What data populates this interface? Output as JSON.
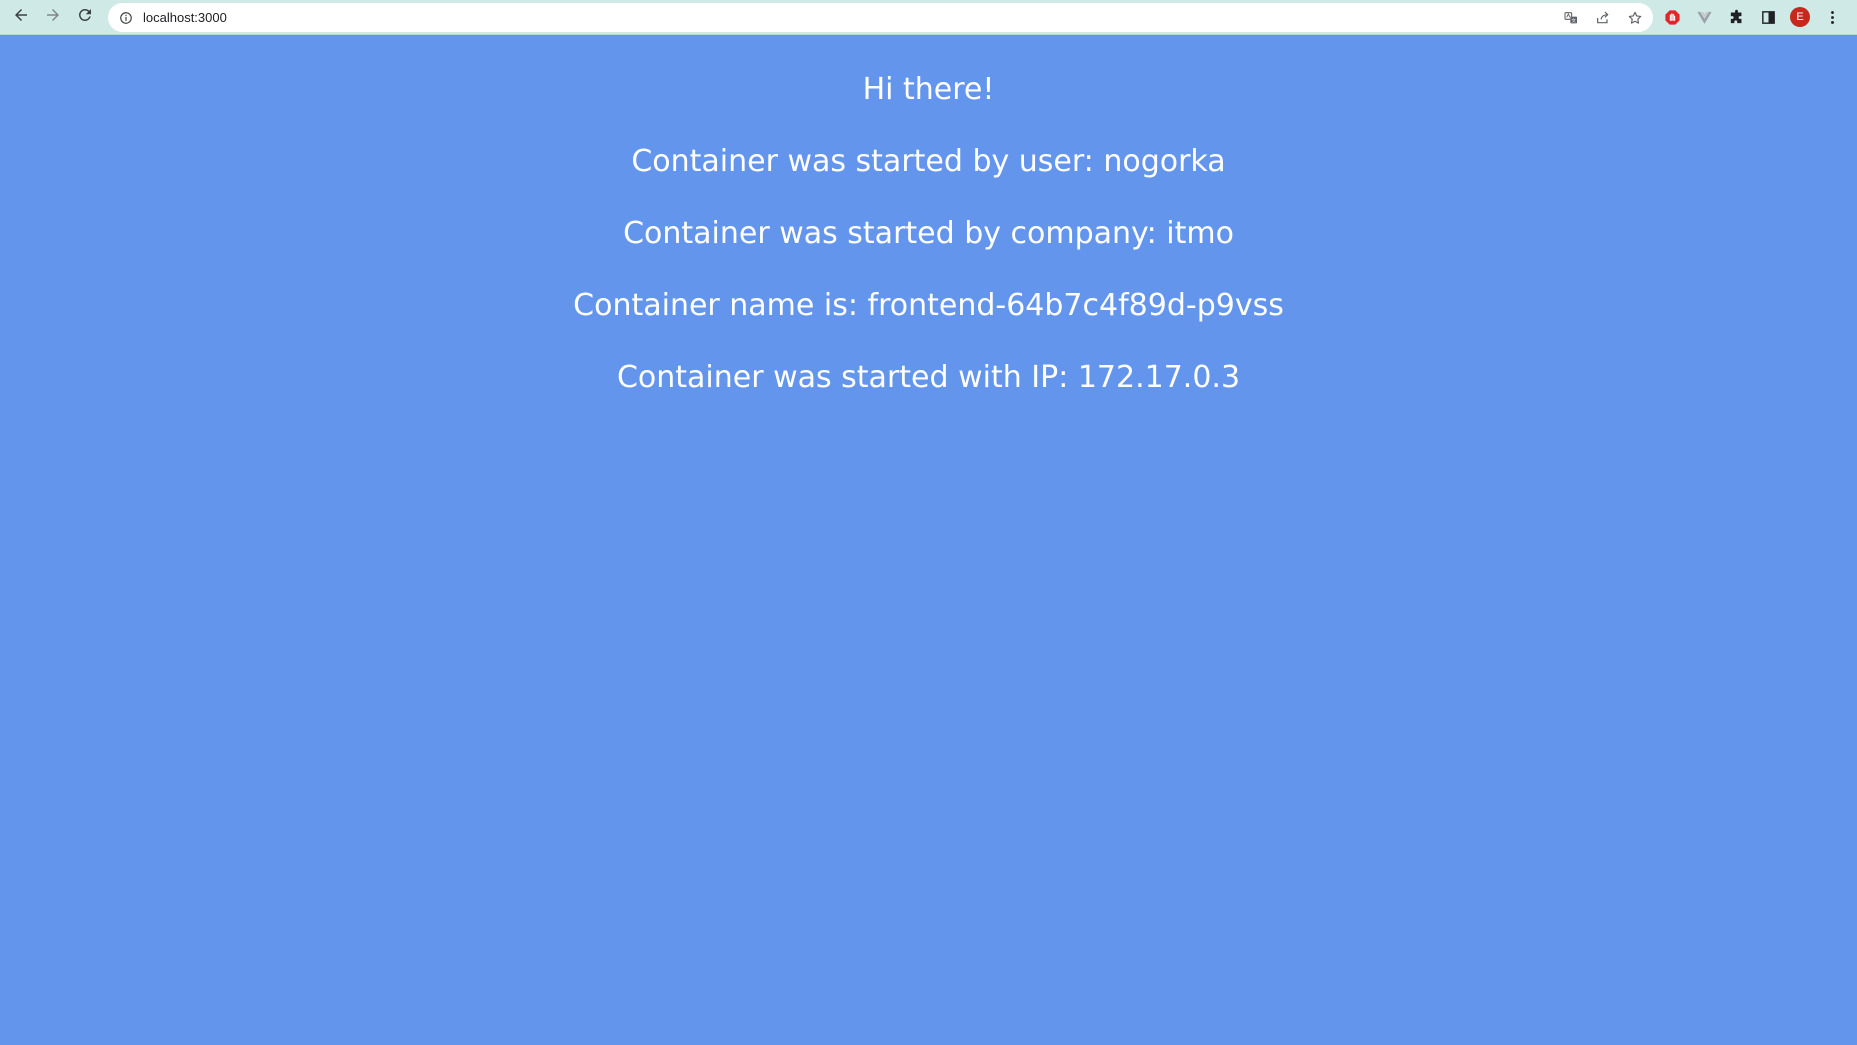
{
  "browser": {
    "url": "localhost:3000",
    "profile_initial": "E",
    "icons": {
      "back": "arrow-left-icon",
      "forward": "arrow-right-icon",
      "reload": "reload-icon",
      "site_info": "info-icon",
      "translate": "translate-icon",
      "share": "share-icon",
      "bookmark": "star-icon",
      "ext_adblock": "stop-hand-icon",
      "ext_vue": "vue-devtools-icon",
      "extensions": "puzzle-icon",
      "side_panel": "side-panel-icon",
      "menu": "kebab-menu-icon"
    },
    "colors": {
      "toolbar_bg": "#cfeae6",
      "avatar_bg": "#c5291e"
    }
  },
  "page": {
    "background": "#6495ED",
    "greeting": "Hi there!",
    "user_line": "Container was started by user: nogorka",
    "company_line": "Container was started by company: itmo",
    "name_line": "Container name is: frontend-64b7c4f89d-p9vss",
    "ip_line": "Container was started with IP: 172.17.0.3"
  }
}
